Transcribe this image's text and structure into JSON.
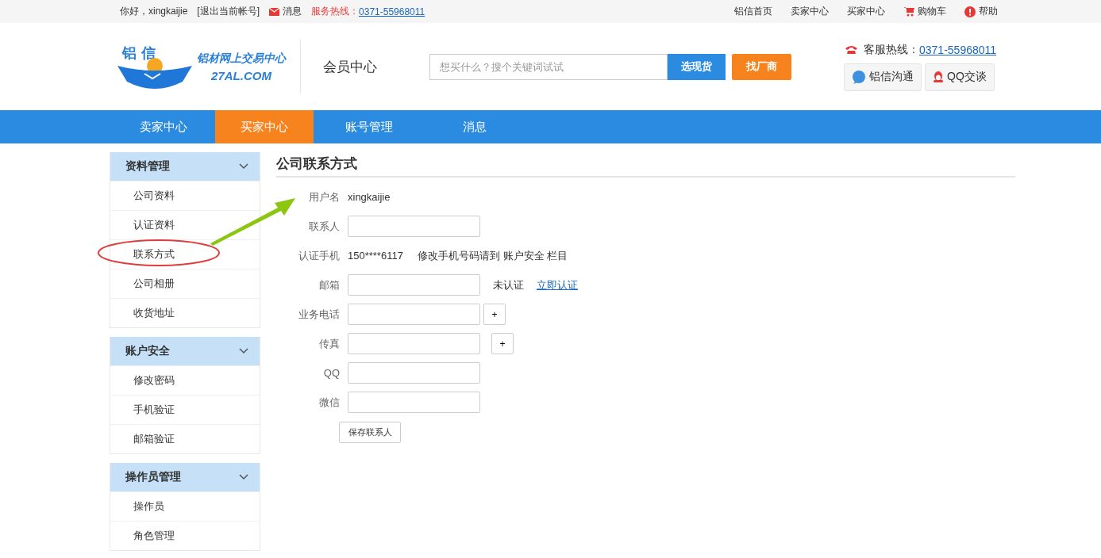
{
  "top_bar": {
    "greeting": "你好，xingkaijie",
    "logout": "[退出当前帐号]",
    "messages": "消息",
    "hotline_label": "服务热线：",
    "hotline_number": "0371-55968011",
    "links": [
      {
        "label": "铝信首页",
        "kind": "text"
      },
      {
        "label": "卖家中心",
        "kind": "text"
      },
      {
        "label": "买家中心",
        "kind": "text"
      },
      {
        "label": "购物车",
        "kind": "cart"
      },
      {
        "label": "帮助",
        "kind": "help"
      }
    ]
  },
  "header": {
    "logo_top": "铝 信",
    "logo_slogan": "铝材网上交易中心",
    "logo_domain": "27AL.COM",
    "section_title": "会员中心",
    "search": {
      "placeholder": "想买什么？搜个关键词试试"
    },
    "search_button": "选现货",
    "factory_button": "找厂商",
    "service_label": "客服热线：",
    "service_number": "0371-55968011",
    "chat_buttons": [
      {
        "label": "铝信沟通",
        "kind": "al"
      },
      {
        "label": "QQ交谈",
        "kind": "qq"
      }
    ]
  },
  "nav": [
    {
      "label": "卖家中心",
      "selected": false
    },
    {
      "label": "买家中心",
      "selected": true
    },
    {
      "label": "账号管理",
      "selected": false
    },
    {
      "label": "消息",
      "selected": false
    }
  ],
  "sidebar": [
    {
      "title": "资料管理",
      "expanded": true,
      "items": [
        "公司资料",
        "认证资料",
        "联系方式",
        "公司相册",
        "收货地址"
      ]
    },
    {
      "title": "账户安全",
      "expanded": true,
      "items": [
        "修改密码",
        "手机验证",
        "邮箱验证"
      ]
    },
    {
      "title": "操作员管理",
      "expanded": true,
      "items": [
        "操作员",
        "角色管理"
      ]
    }
  ],
  "form": {
    "title": "公司联系方式",
    "rows": [
      {
        "kind": "text",
        "label": "用户名",
        "value": "xingkaijie"
      },
      {
        "kind": "input",
        "label": "联系人"
      },
      {
        "kind": "text",
        "label": "认证手机",
        "value": "150****6117",
        "note": "修改手机号码请到 账户安全 栏目"
      },
      {
        "kind": "verify",
        "label": "邮箱",
        "status": "未认证",
        "link": "立即认证"
      },
      {
        "kind": "add",
        "label": "业务电话",
        "button": "+"
      },
      {
        "kind": "add",
        "label": "传真",
        "button": "+"
      },
      {
        "kind": "input",
        "label": "QQ"
      },
      {
        "kind": "input",
        "label": "微信"
      }
    ],
    "save_button": "保存联系人"
  }
}
